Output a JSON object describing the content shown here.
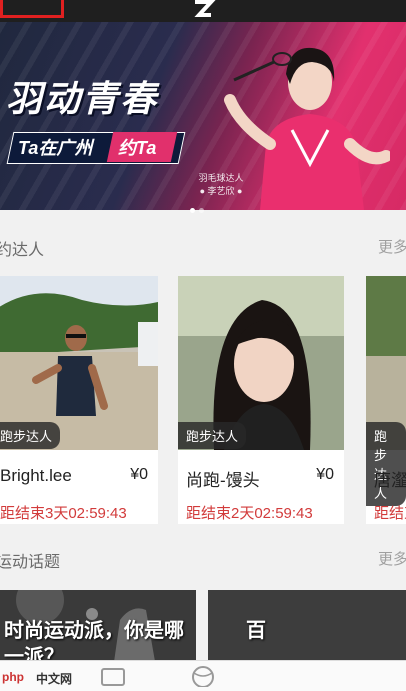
{
  "banner": {
    "title": "羽动青春",
    "tag_left": "Ta在广州",
    "tag_right": "约Ta",
    "caption_line1": "羽毛球达人",
    "caption_line2": "● 李艺欣 ●",
    "slide_count": 2,
    "active_slide": 1
  },
  "section_experts": {
    "title": "约达人",
    "more": "更多"
  },
  "cards": [
    {
      "tag": "跑步达人",
      "name": "Bright.lee",
      "price": "¥0",
      "timer": "距结束3天02:59:43"
    },
    {
      "tag": "跑步达人",
      "name": "尚跑-馒头",
      "price": "¥0",
      "timer": "距结束2天02:59:43"
    },
    {
      "tag": "跑步达人",
      "name": "唐瀣",
      "price": "",
      "timer": "距结束"
    }
  ],
  "section_topics": {
    "title": "运动话题",
    "more": "更多"
  },
  "topics": [
    {
      "text": "时尚运动派，你是哪一派？"
    },
    {
      "text": "百"
    }
  ],
  "watermark": {
    "left": "php",
    "right": "中文网"
  },
  "colors": {
    "accent": "#e1306c",
    "timer": "#d23b3b",
    "topbar": "#1f1f1f"
  }
}
